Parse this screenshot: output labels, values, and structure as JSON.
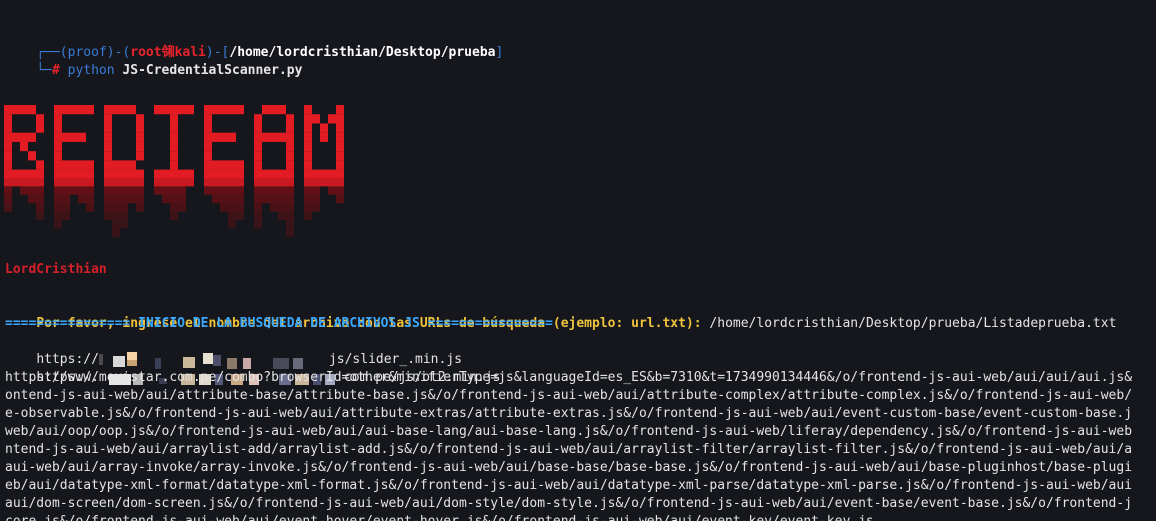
{
  "prompt": {
    "open_paren": "(proof)",
    "dash": "-(",
    "root": "root",
    "skull": "㋿",
    "host": "kali",
    "close": ")-[",
    "path": "/home/lordcristhian/Desktop/prueba",
    "bracket_end": "]",
    "corner_top": "┌──",
    "corner_bottom": "└─",
    "hash": "#",
    "command_prog": "python",
    "command_arg": "JS-CredentialScanner.py"
  },
  "banner": {
    "text": "REDTEAM",
    "color": "#e31b23",
    "drip_color": "#7a0e12"
  },
  "author": "LordCristhian",
  "question": "Por favor, ingrese el nombre del archivo con las URLs de búsqueda (ejemplo: url.txt):",
  "answer": " /home/lordcristhian/Desktop/prueba/Listadeprueba.txt",
  "search_header": "================ INICIO DE LA BUSQUEDA DE ARCHIVOS JS ================",
  "urls": {
    "url1_prefix": "https://",
    "url1_suffix": "js/slider_.min.js",
    "url2_prefix": "https://",
    "url2_suffix": "com.pe/js/ot2.min.js",
    "long_lines": [
      "https://www.movistar.com.pe/combo?browserId=other&minifierType=js&languageId=es_ES&b=7310&t=1734990134446&/o/frontend-js-aui-web/aui/aui/aui.js&",
      "ontend-js-aui-web/aui/attribute-base/attribute-base.js&/o/frontend-js-aui-web/aui/attribute-complex/attribute-complex.js&/o/frontend-js-aui-web/",
      "e-observable.js&/o/frontend-js-aui-web/aui/attribute-extras/attribute-extras.js&/o/frontend-js-aui-web/aui/event-custom-base/event-custom-base.j",
      "web/aui/oop/oop.js&/o/frontend-js-aui-web/aui/aui-base-lang/aui-base-lang.js&/o/frontend-js-aui-web/liferay/dependency.js&/o/frontend-js-aui-web",
      "ntend-js-aui-web/aui/arraylist-add/arraylist-add.js&/o/frontend-js-aui-web/aui/arraylist-filter/arraylist-filter.js&/o/frontend-js-aui-web/aui/a",
      "aui-web/aui/array-invoke/array-invoke.js&/o/frontend-js-aui-web/aui/base-base/base-base.js&/o/frontend-js-aui-web/aui/base-pluginhost/base-plugi",
      "eb/aui/datatype-xml-format/datatype-xml-format.js&/o/frontend-js-aui-web/aui/datatype-xml-parse/datatype-xml-parse.js&/o/frontend-js-aui-web/aui",
      "aui/dom-screen/dom-screen.js&/o/frontend-js-aui-web/aui/dom-style/dom-style.js&/o/frontend-js-aui-web/aui/event-base/event-base.js&/o/frontend-j",
      "core.js&/o/frontend-js-aui-web/aui/event-hover/event-hover.js&/o/frontend-js-aui-web/aui/event-key/event-key.js"
    ]
  }
}
